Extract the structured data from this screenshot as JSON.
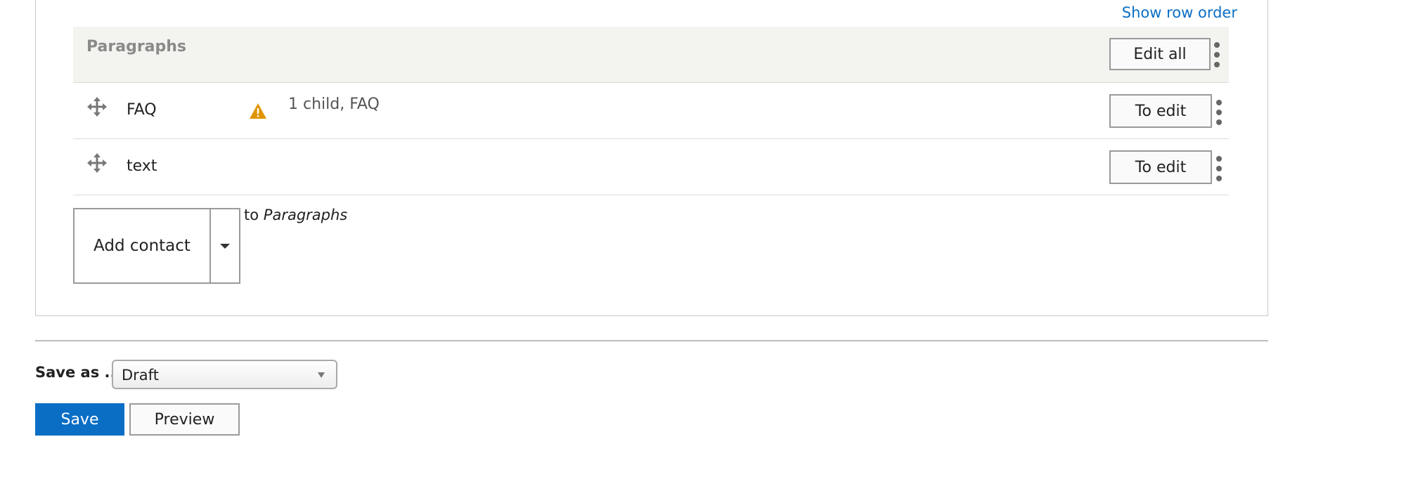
{
  "header": {
    "show_row_order": "Show row order"
  },
  "paragraphs": {
    "title": "Paragraphs",
    "edit_all": "Edit all",
    "rows": [
      {
        "label": "FAQ",
        "summary": "1 child, FAQ",
        "edit": "To edit",
        "has_warning": true
      },
      {
        "label": "text",
        "summary": "",
        "edit": "To edit",
        "has_warning": false
      }
    ],
    "add_button": "Add contact",
    "add_to_prefix": "to",
    "add_to_target": "Paragraphs"
  },
  "footer": {
    "save_as_label": "Save as ...:",
    "state_value": "Draft",
    "save": "Save",
    "preview": "Preview"
  },
  "colors": {
    "link": "#0a6ec5",
    "primary_button": "#0a6ec5",
    "header_bg": "#f3f3ef",
    "warning": "#e09600"
  },
  "icons": {
    "drag": "move-cross-icon",
    "warning": "warning-triangle-icon",
    "more": "kebab-menu-icon",
    "dropdown": "caret-down-icon"
  }
}
